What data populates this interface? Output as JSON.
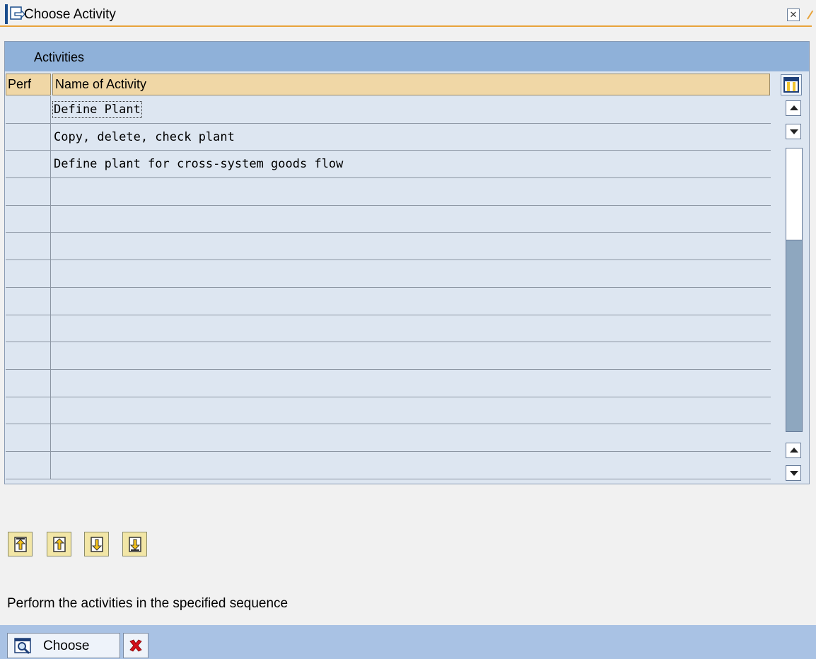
{
  "window": {
    "title": "Choose Activity"
  },
  "panel": {
    "title": "Activities"
  },
  "table": {
    "headers": {
      "perf": "Perf",
      "name": "Name of Activity"
    },
    "rows": [
      {
        "perf": "",
        "name": "Define Plant"
      },
      {
        "perf": "",
        "name": "Copy, delete, check plant"
      },
      {
        "perf": "",
        "name": "Define plant for cross-system goods flow"
      },
      {
        "perf": "",
        "name": ""
      },
      {
        "perf": "",
        "name": ""
      },
      {
        "perf": "",
        "name": ""
      },
      {
        "perf": "",
        "name": ""
      },
      {
        "perf": "",
        "name": ""
      },
      {
        "perf": "",
        "name": ""
      },
      {
        "perf": "",
        "name": ""
      },
      {
        "perf": "",
        "name": ""
      },
      {
        "perf": "",
        "name": ""
      },
      {
        "perf": "",
        "name": ""
      },
      {
        "perf": "",
        "name": ""
      }
    ]
  },
  "hint": "Perform the activities in the specified sequence",
  "footer": {
    "choose_label": "Choose"
  },
  "colors": {
    "accent": "#e8a33b",
    "panel_header": "#8fb1d9",
    "column_header": "#f0d7a6",
    "footer": "#a9c2e4"
  },
  "icons": [
    "window-icon",
    "close-icon",
    "table-settings-icon",
    "page-first-icon",
    "page-up-icon",
    "page-down-icon",
    "page-last-icon",
    "choose-icon",
    "cancel-icon"
  ]
}
